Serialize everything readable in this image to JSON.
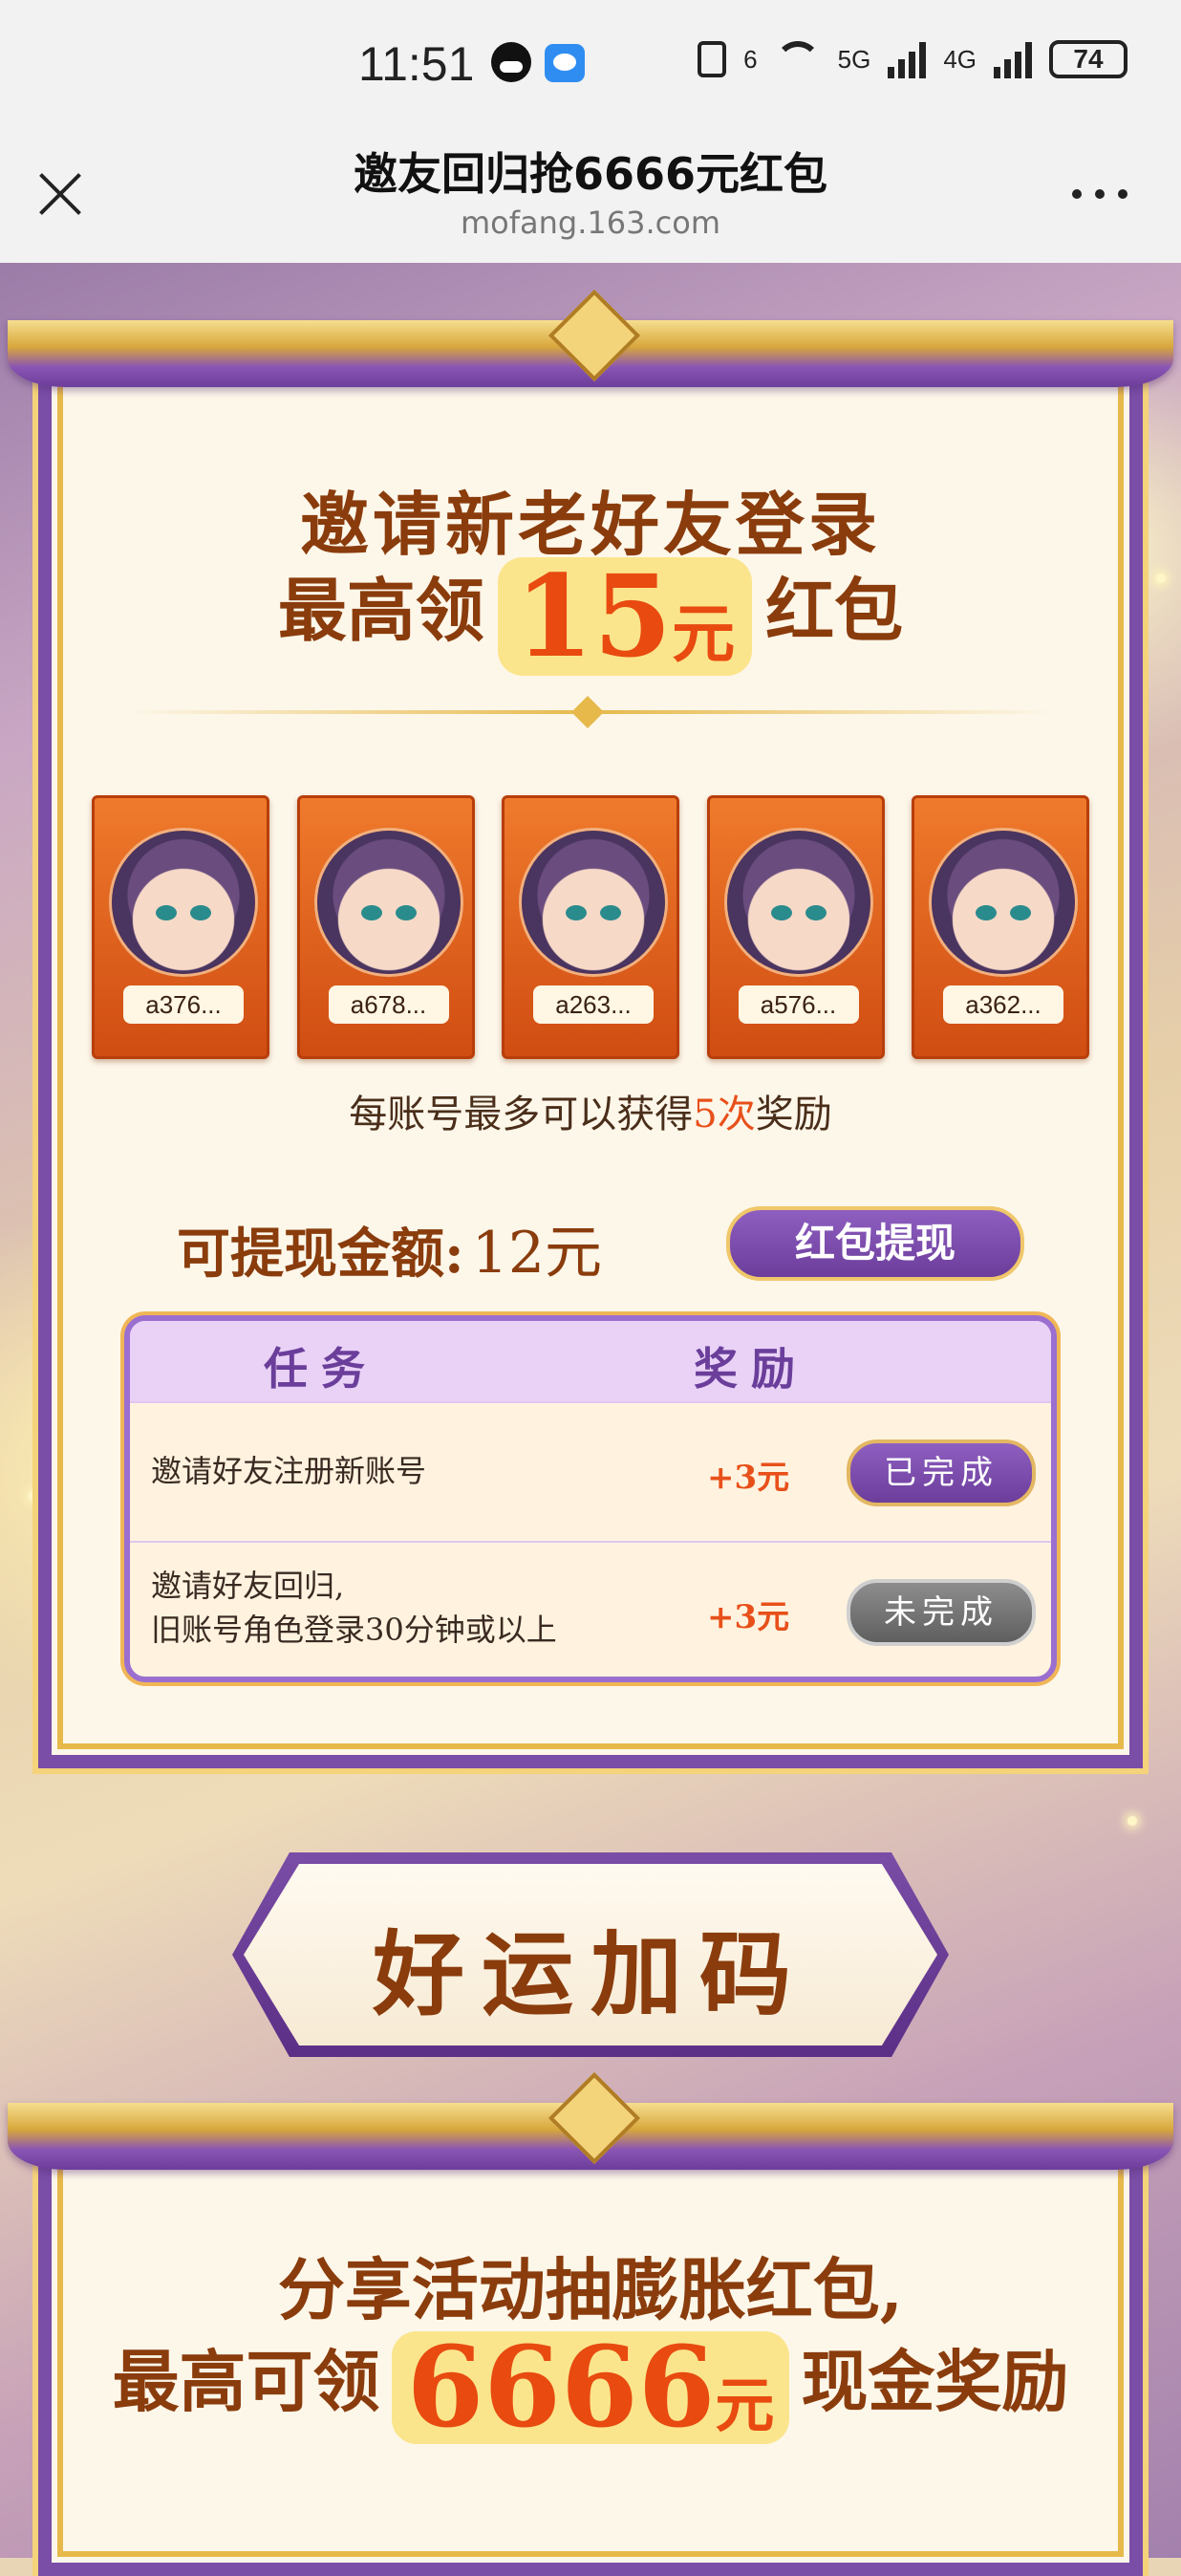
{
  "status_bar": {
    "time": "11:51",
    "net_6": "6",
    "net_5g": "5G",
    "net_4g": "4G",
    "battery": "74"
  },
  "header": {
    "title": "邀友回归抢6666元红包",
    "url": "mofang.163.com"
  },
  "invite": {
    "line1": "邀请新老好友登录",
    "line2_prefix": "最高领",
    "amount": "15",
    "unit": "元",
    "line2_suffix": "红包"
  },
  "friends": [
    {
      "name": "a376..."
    },
    {
      "name": "a678..."
    },
    {
      "name": "a263..."
    },
    {
      "name": "a576..."
    },
    {
      "name": "a362..."
    }
  ],
  "note": {
    "prefix": "每账号最多可以获得",
    "highlight": "5次",
    "suffix": "奖励"
  },
  "withdraw": {
    "label": "可提现金额:",
    "value": "12元",
    "button": "红包提现"
  },
  "tasks": {
    "col_task": "任务",
    "col_reward": "奖励",
    "rows": [
      {
        "desc_line1": "邀请好友注册新账号",
        "desc_line2": "",
        "reward": "+3元",
        "status": "已完成"
      },
      {
        "desc_line1": "邀请好友回归,",
        "desc_line2": "旧账号角色登录30分钟或以上",
        "reward": "+3元",
        "status": "未完成"
      }
    ]
  },
  "lucky": {
    "title": "好运加码"
  },
  "share": {
    "line1": "分享活动抽膨胀红包,",
    "line2_prefix": "最高可领",
    "amount": "6666",
    "unit": "元",
    "line2_suffix": "现金奖励"
  },
  "colors": {
    "accent_purple": "#7a4da6",
    "gold": "#e6b94a",
    "title_brown": "#8a3c0c",
    "highlight_orange": "#e8501a"
  }
}
